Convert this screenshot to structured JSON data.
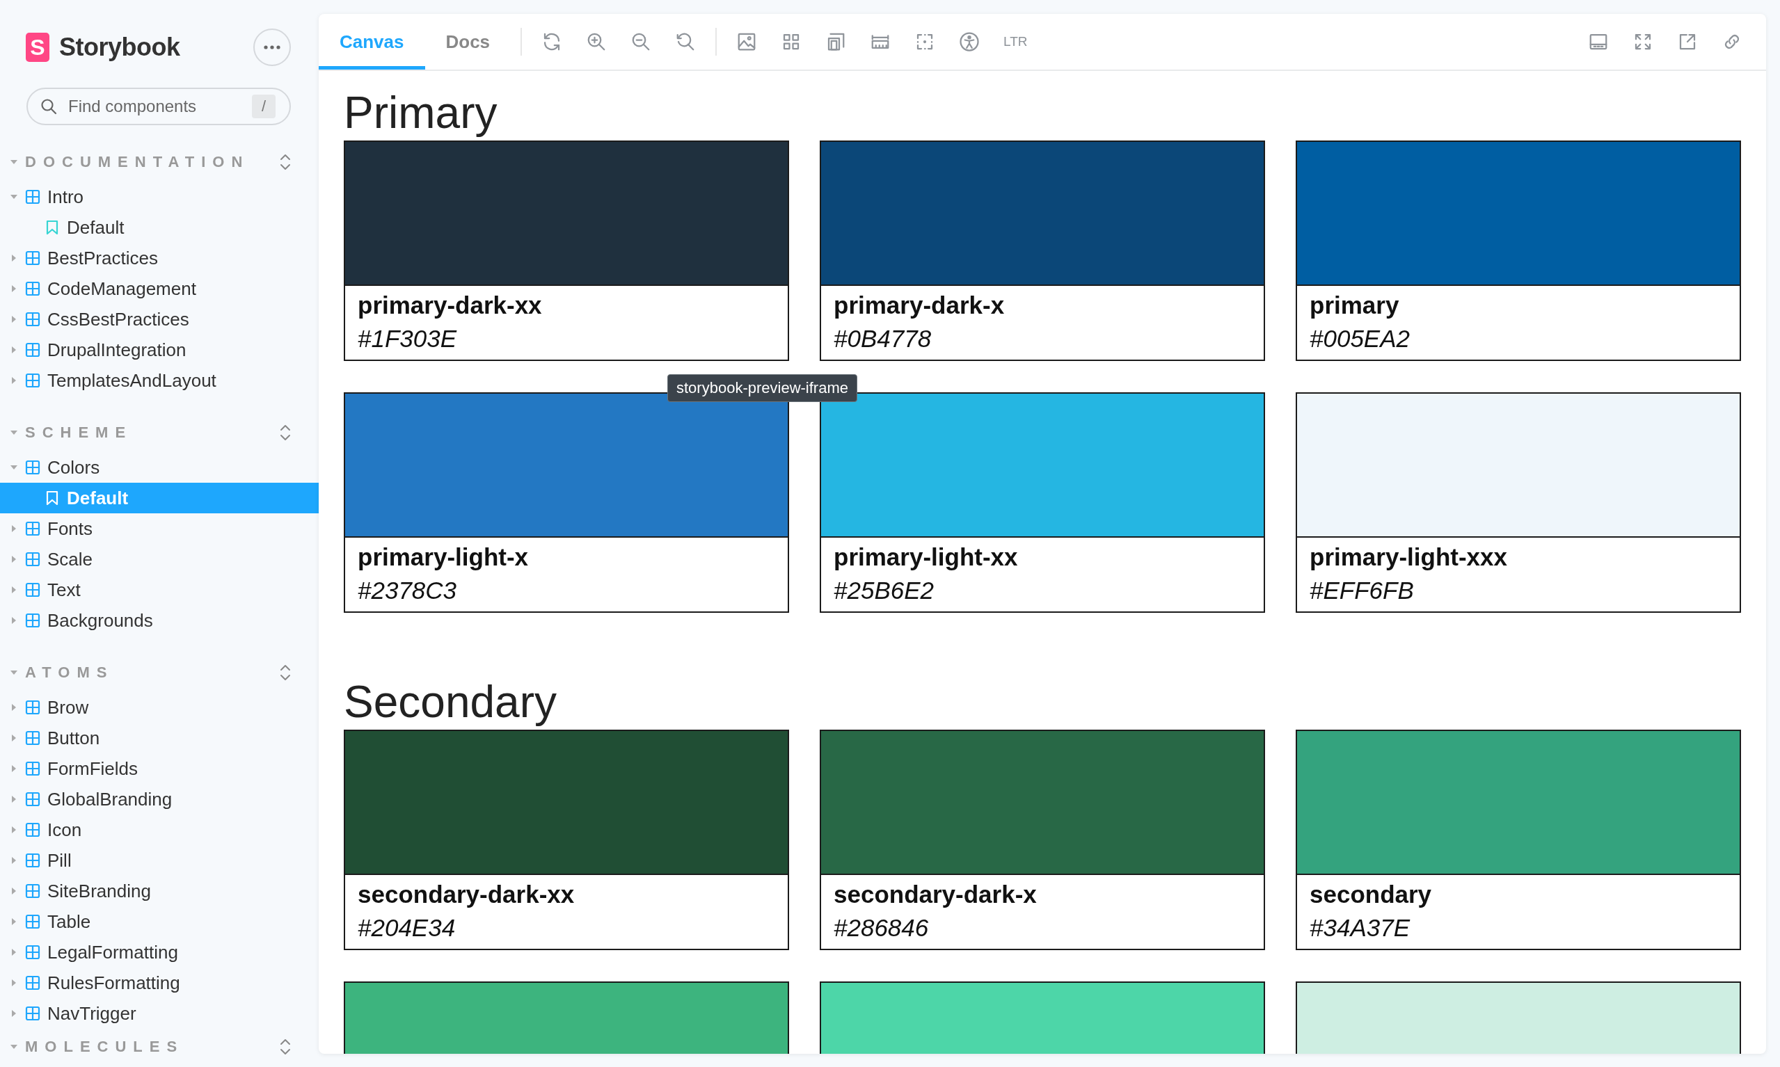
{
  "brand": {
    "logo_letter": "S",
    "name": "Storybook"
  },
  "sidebar": {
    "search": {
      "placeholder": "Find components",
      "shortcut": "/"
    },
    "sections": [
      {
        "title": "DOCUMENTATION",
        "expanded": true,
        "items": [
          {
            "label": "Intro",
            "kind": "component",
            "expanded": true,
            "selected": false,
            "children": [
              {
                "label": "Default",
                "kind": "story",
                "selected": false
              }
            ]
          },
          {
            "label": "BestPractices",
            "kind": "component",
            "expanded": false,
            "selected": false
          },
          {
            "label": "CodeManagement",
            "kind": "component",
            "expanded": false,
            "selected": false
          },
          {
            "label": "CssBestPractices",
            "kind": "component",
            "expanded": false,
            "selected": false
          },
          {
            "label": "DrupalIntegration",
            "kind": "component",
            "expanded": false,
            "selected": false
          },
          {
            "label": "TemplatesAndLayout",
            "kind": "component",
            "expanded": false,
            "selected": false
          }
        ]
      },
      {
        "title": "SCHEME",
        "expanded": true,
        "items": [
          {
            "label": "Colors",
            "kind": "component",
            "expanded": true,
            "selected": false,
            "children": [
              {
                "label": "Default",
                "kind": "story",
                "selected": true
              }
            ]
          },
          {
            "label": "Fonts",
            "kind": "component",
            "expanded": false,
            "selected": false
          },
          {
            "label": "Scale",
            "kind": "component",
            "expanded": false,
            "selected": false
          },
          {
            "label": "Text",
            "kind": "component",
            "expanded": false,
            "selected": false
          },
          {
            "label": "Backgrounds",
            "kind": "component",
            "expanded": false,
            "selected": false
          }
        ]
      },
      {
        "title": "ATOMS",
        "expanded": true,
        "items": [
          {
            "label": "Brow",
            "kind": "component",
            "expanded": false,
            "selected": false
          },
          {
            "label": "Button",
            "kind": "component",
            "expanded": false,
            "selected": false
          },
          {
            "label": "FormFields",
            "kind": "component",
            "expanded": false,
            "selected": false
          },
          {
            "label": "GlobalBranding",
            "kind": "component",
            "expanded": false,
            "selected": false
          },
          {
            "label": "Icon",
            "kind": "component",
            "expanded": false,
            "selected": false
          },
          {
            "label": "Pill",
            "kind": "component",
            "expanded": false,
            "selected": false
          },
          {
            "label": "SiteBranding",
            "kind": "component",
            "expanded": false,
            "selected": false
          },
          {
            "label": "Table",
            "kind": "component",
            "expanded": false,
            "selected": false
          },
          {
            "label": "LegalFormatting",
            "kind": "component",
            "expanded": false,
            "selected": false
          },
          {
            "label": "RulesFormatting",
            "kind": "component",
            "expanded": false,
            "selected": false
          },
          {
            "label": "NavTrigger",
            "kind": "component",
            "expanded": false,
            "selected": false
          }
        ]
      },
      {
        "title": "MOLECULES",
        "expanded": true
      }
    ]
  },
  "toolbar": {
    "tabs": [
      {
        "label": "Canvas",
        "selected": true
      },
      {
        "label": "Docs",
        "selected": false
      }
    ],
    "direction": "LTR"
  },
  "tooltip": "storybook-preview-iframe",
  "groups": [
    {
      "title": "Primary",
      "swatches": [
        {
          "name": "primary-dark-xx",
          "hex": "#1F303E",
          "color": "#1f303e"
        },
        {
          "name": "primary-dark-x",
          "hex": "#0B4778",
          "color": "#0b4778"
        },
        {
          "name": "primary",
          "hex": "#005EA2",
          "color": "#005ea2"
        },
        {
          "name": "primary-light-x",
          "hex": "#2378C3",
          "color": "#2378c3"
        },
        {
          "name": "primary-light-xx",
          "hex": "#25B6E2",
          "color": "#25b6e2"
        },
        {
          "name": "primary-light-xxx",
          "hex": "#EFF6FB",
          "color": "#eff6fb"
        }
      ]
    },
    {
      "title": "Secondary",
      "swatches": [
        {
          "name": "secondary-dark-xx",
          "hex": "#204E34",
          "color": "#204e34"
        },
        {
          "name": "secondary-dark-x",
          "hex": "#286846",
          "color": "#286846"
        },
        {
          "name": "secondary",
          "hex": "#34A37E",
          "color": "#34a37e"
        },
        {
          "color": "#3db47e"
        },
        {
          "color": "#4dd6a8"
        },
        {
          "color": "#ceeee2"
        }
      ]
    }
  ]
}
